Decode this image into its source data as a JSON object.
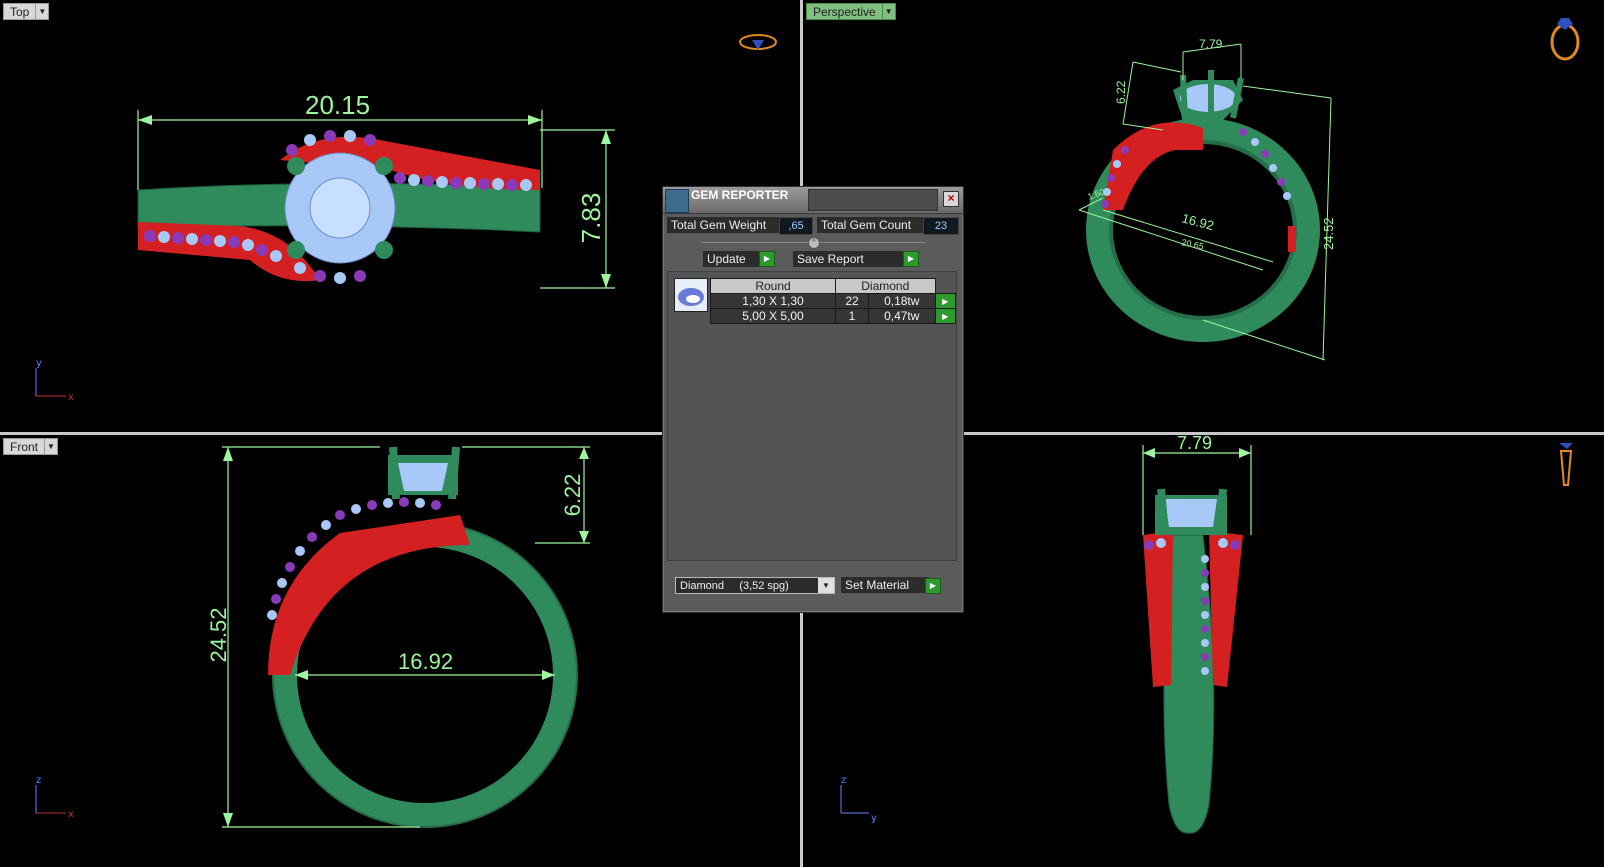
{
  "viewports": {
    "top": {
      "label": "Top",
      "axis_v": "y",
      "axis_h": "x"
    },
    "perspective": {
      "label": "Perspective"
    },
    "front": {
      "label": "Front",
      "axis_v": "z",
      "axis_h": "x"
    },
    "side": {
      "axis_v": "z",
      "axis_h": "y"
    }
  },
  "dimensions": {
    "top_width": "20.15",
    "top_height": "7.83",
    "persp_top": "7.79",
    "persp_left": "6.22",
    "persp_inner": "16.92",
    "persp_height": "24.52",
    "persp_small": "1.60",
    "persp_inner2": "20.65",
    "front_height": "24.52",
    "front_prong": "6.22",
    "front_inner": "16.92",
    "side_width": "7.79"
  },
  "gem_reporter": {
    "title": "GEM REPORTER",
    "total_weight_label": "Total Gem Weight",
    "total_weight_value": ",65",
    "total_count_label": "Total Gem Count",
    "total_count_value": "23",
    "update_label": "Update",
    "save_report_label": "Save Report",
    "table_headers": [
      "Round",
      "Diamond"
    ],
    "rows": [
      {
        "size": "1,30 X 1,30",
        "count": "22",
        "weight": "0,18tw"
      },
      {
        "size": "5,00 X 5,00",
        "count": "1",
        "weight": "0,47tw"
      }
    ],
    "material_select": "Diamond     (3,52 spg)",
    "set_material_label": "Set Material"
  },
  "colors": {
    "metal": "#2f8a5c",
    "highlight": "#d42020",
    "gem": "#a8c8f8",
    "side_stone": "#8a3ab8",
    "dimension": "#9df59d"
  }
}
